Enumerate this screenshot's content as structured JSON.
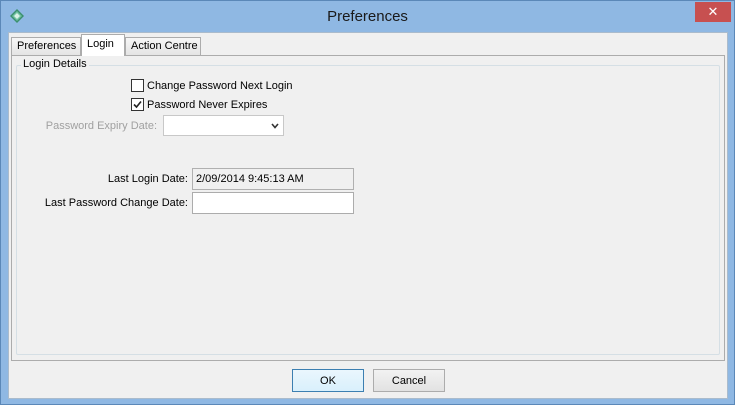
{
  "window": {
    "title": "Preferences",
    "close_glyph": "✕"
  },
  "tabs": [
    {
      "label": "Preferences",
      "active": false
    },
    {
      "label": "Login",
      "active": true
    },
    {
      "label": "Action Centre",
      "active": false
    }
  ],
  "login": {
    "group_label": "Login Details",
    "change_password_next_login": {
      "label": "Change Password Next Login",
      "checked": false
    },
    "password_never_expires": {
      "label": "Password Never Expires",
      "checked": true
    },
    "password_expiry_date": {
      "label": "Password Expiry Date:",
      "value": "",
      "enabled": false
    },
    "last_login_date": {
      "label": "Last Login Date:",
      "value": "2/09/2014 9:45:13 AM"
    },
    "last_password_change_date": {
      "label": "Last Password Change Date:",
      "value": ""
    }
  },
  "buttons": {
    "ok": "OK",
    "cancel": "Cancel"
  }
}
